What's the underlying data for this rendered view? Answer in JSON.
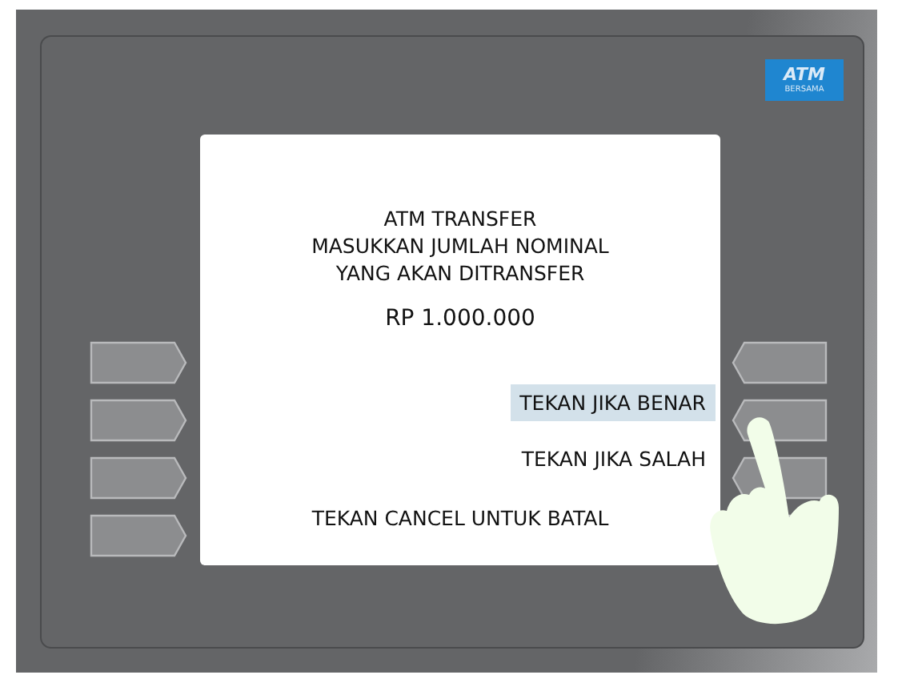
{
  "logo": {
    "brand": "ATM",
    "subtitle": "BERSAMA"
  },
  "screen": {
    "lines": [
      "ATM TRANSFER",
      "MASUKKAN JUMLAH NOMINAL",
      "YANG AKAN DITRANSFER"
    ],
    "amount": "RP 1.000.000",
    "options": [
      {
        "label": "TEKAN JIKA BENAR",
        "kind": "right",
        "selected": true
      },
      {
        "label": "TEKAN JIKA SALAH",
        "kind": "right",
        "selected": false
      },
      {
        "label": "TEKAN CANCEL UNTUK BATAL",
        "kind": "center",
        "selected": false
      }
    ]
  }
}
